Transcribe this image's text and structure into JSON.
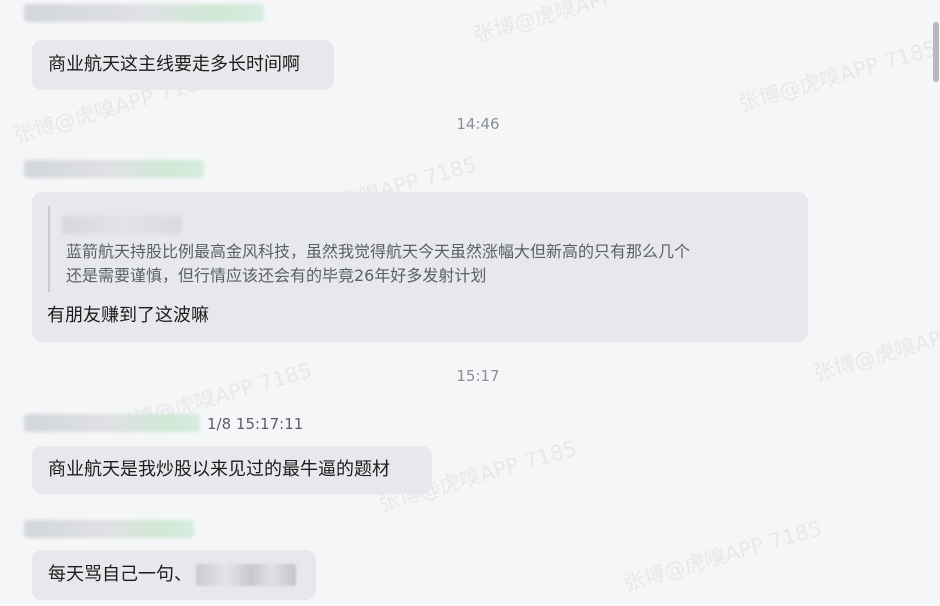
{
  "messages": [
    {
      "id": "m1",
      "text": "商业航天这主线要走多长时间啊"
    },
    {
      "id": "m2",
      "text": "有朋友赚到了这波嘛",
      "quote": {
        "line1": "蓝箭航天持股比例最高金风科技，虽然我觉得航天今天虽然涨幅大但新高的只有那么几个",
        "line2": "还是需要谨慎，但行情应该还会有的毕竟26年好多发射计划"
      }
    },
    {
      "id": "m3",
      "text": "商业航天是我炒股以来见过的最牛逼的题材",
      "sender_time": "1/8 15:17:11"
    },
    {
      "id": "m4",
      "text": "每天骂自己一句、"
    }
  ],
  "timestamps": {
    "t1": "14:46",
    "t2": "15:17"
  },
  "watermark": {
    "text": "张博@虎嗅APP 7185"
  }
}
